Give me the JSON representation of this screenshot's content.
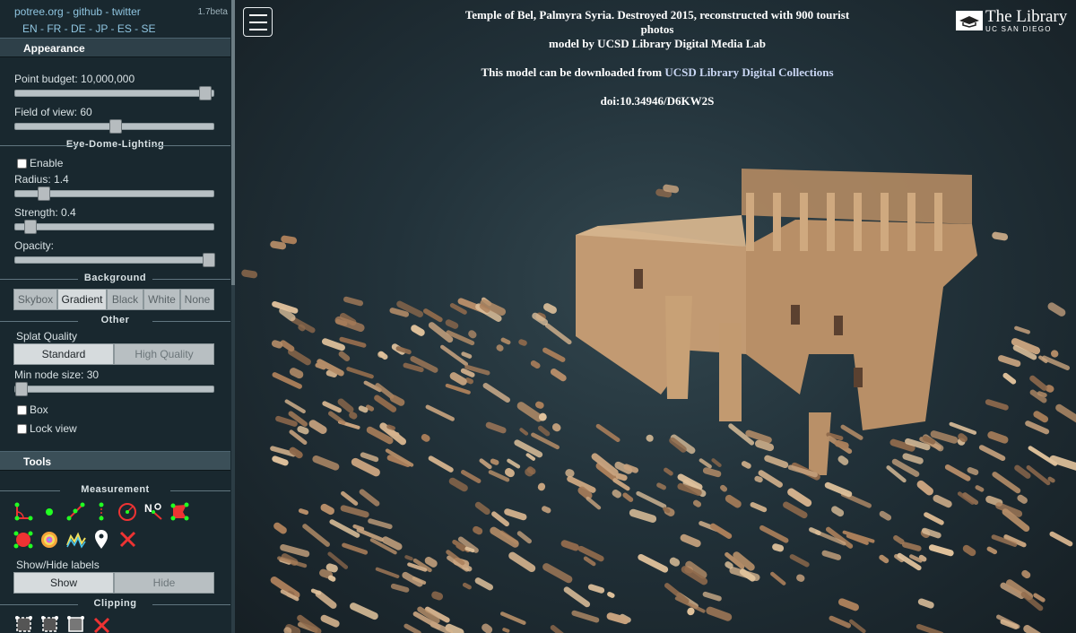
{
  "sidebar": {
    "links": {
      "potree": "potree.org",
      "sep1": " - ",
      "github": "github",
      "sep2": " - ",
      "twitter": "twitter"
    },
    "version": "1.7beta",
    "languages": [
      "EN",
      "FR",
      "DE",
      "JP",
      "ES",
      "SE"
    ],
    "appearance": {
      "header": "Appearance",
      "point_budget": "Point budget: 10,000,000",
      "point_budget_level": 0.98,
      "fov": "Field of view: 60",
      "fov_level": 0.5
    },
    "edl": {
      "title": "Eye-Dome-Lighting",
      "enable": "Enable",
      "radius": "Radius: 1.4",
      "radius_level": 0.12,
      "strength": "Strength: 0.4",
      "strength_level": 0.05,
      "opacity": "Opacity:",
      "opacity_level": 1.0
    },
    "background": {
      "title": "Background",
      "options": [
        "Skybox",
        "Gradient",
        "Black",
        "White",
        "None"
      ],
      "selected": "Gradient"
    },
    "other": {
      "title": "Other",
      "splat_quality": "Splat Quality",
      "standard": "Standard",
      "high_quality": "High Quality",
      "min_node_size": "Min node size: 30",
      "min_node_level": 0.0,
      "box": "Box",
      "lock_view": "Lock view"
    },
    "tools": {
      "header": "Tools",
      "measurement": "Measurement",
      "show_hide_labels": "Show/Hide labels",
      "show": "Show",
      "hide": "Hide",
      "clipping": "Clipping"
    }
  },
  "viewer": {
    "title_line1": "Temple of Bel, Palmyra Syria. Destroyed 2015, reconstructed with 900 tourist",
    "title_line2": "photos",
    "title_line3": "model by UCSD Library Digital Media Lab",
    "download_text": "This model can be downloaded from ",
    "download_link": "UCSD Library Digital Collections",
    "doi": "doi:10.34946/D6KW2S",
    "logo_big": "The Library",
    "logo_small": "UC SAN DIEGO"
  },
  "colors": {
    "accent_link": "#8fc5e0",
    "point_cloud": "#c9a47f",
    "sidebar_bg": "#19282f"
  }
}
